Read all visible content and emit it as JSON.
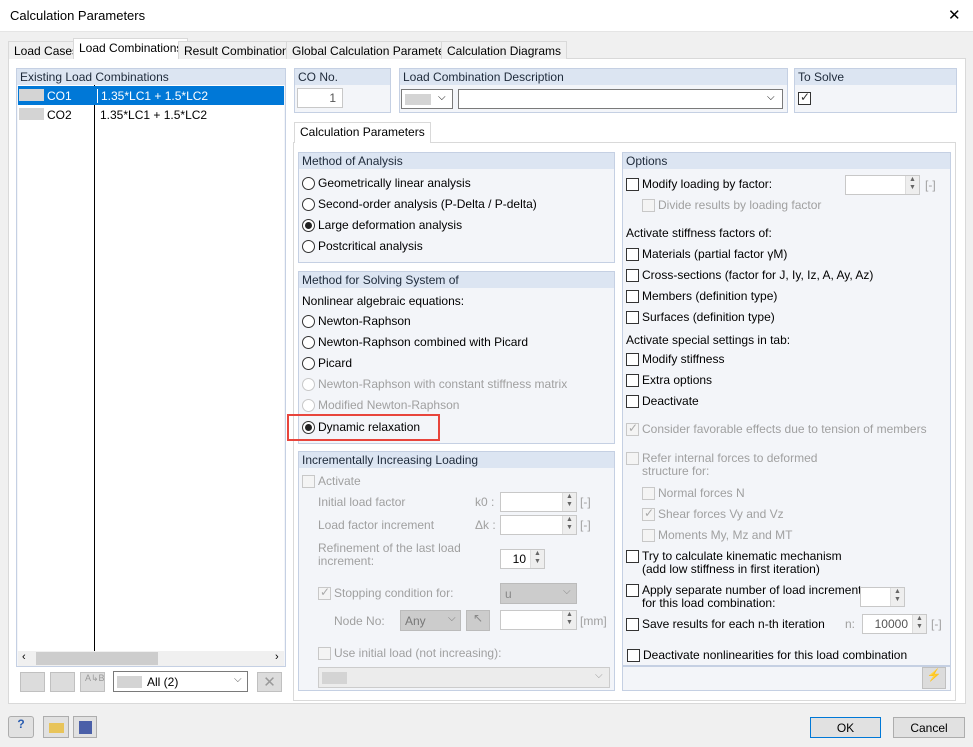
{
  "window": {
    "title": "Calculation Parameters",
    "close": "✕"
  },
  "tabs": [
    "Load Cases",
    "Load Combinations",
    "Result Combinations",
    "Global Calculation Parameters",
    "Calculation Diagrams"
  ],
  "left": {
    "header": "Existing Load Combinations",
    "rows": [
      {
        "no": "CO1",
        "desc": "1.35*LC1 + 1.5*LC2"
      },
      {
        "no": "CO2",
        "desc": "1.35*LC1 + 1.5*LC2"
      }
    ],
    "filter": "All (2)"
  },
  "co": {
    "label": "CO No.",
    "value": "1"
  },
  "description": {
    "label": "Load Combination Description",
    "value": ""
  },
  "to_solve": {
    "label": "To Solve",
    "checked": true
  },
  "subtab": "Calculation Parameters",
  "method_analysis": {
    "header": "Method of Analysis",
    "options": [
      "Geometrically linear analysis",
      "Second-order analysis (P-Delta / P-delta)",
      "Large deformation analysis",
      "Postcritical analysis"
    ],
    "selected": 2
  },
  "method_solving": {
    "header": "Method for Solving System of",
    "sublabel": "Nonlinear algebraic equations:",
    "options": [
      "Newton-Raphson",
      "Newton-Raphson combined with Picard",
      "Picard",
      "Newton-Raphson with constant stiffness matrix",
      "Modified Newton-Raphson",
      "Dynamic relaxation"
    ],
    "selected": 5
  },
  "incremental": {
    "header": "Incrementally Increasing Loading",
    "activate": "Activate",
    "initial": "Initial load factor",
    "initial_sym": "k0 :",
    "increment": "Load factor increment",
    "increment_sym": "Δk :",
    "unit": "[-]",
    "refinement": "Refinement of the last load increment:",
    "refinement_value": "10",
    "stopping": "Stopping condition for:",
    "stopping_value": "u",
    "node": "Node No:",
    "node_value": "Any",
    "mm": "[mm]",
    "use_initial": "Use initial load (not increasing):"
  },
  "options": {
    "header": "Options",
    "modify": "Modify loading by factor:",
    "unit": "[-]",
    "divide": "Divide results by loading factor",
    "stiff_label": "Activate stiffness factors of:",
    "materials": "Materials (partial factor γM)",
    "cross": "Cross-sections (factor for J, Iy, Iz, A, Ay, Az)",
    "members": "Members (definition type)",
    "surfaces": "Surfaces (definition type)",
    "special_label": "Activate special settings in tab:",
    "mod_stiff": "Modify stiffness",
    "extra": "Extra options",
    "deactivate": "Deactivate",
    "consider": "Consider favorable effects due to tension of members",
    "refer1": "Refer internal forces to deformed",
    "refer2": "structure for:",
    "normal": "Normal forces N",
    "shear": "Shear forces Vy and Vz",
    "moments": "Moments My, Mz and MT",
    "try1": "Try to calculate kinematic mechanism",
    "try2": "(add low stiffness in first iteration)",
    "apply1": "Apply separate number of load increments",
    "apply2": "for this load combination:",
    "save": "Save results for each n-th iteration",
    "n": "n:",
    "n_value": "10000",
    "deact_nonlin": "Deactivate nonlinearities for this load combination"
  },
  "buttons": {
    "ok": "OK",
    "cancel": "Cancel"
  },
  "colors": {
    "selection": "#0078d7",
    "highlight": "#e81123"
  }
}
